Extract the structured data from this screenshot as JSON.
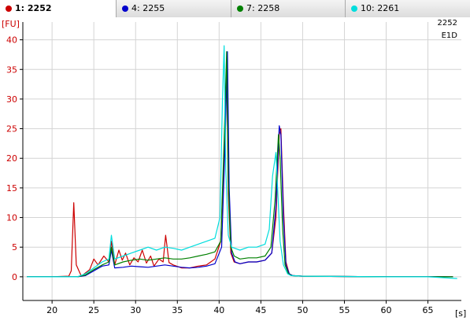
{
  "tabs": [
    {
      "label": "1: 2252",
      "color": "#cc0000",
      "active": true
    },
    {
      "label": "4: 2255",
      "color": "#0000cc",
      "active": false
    },
    {
      "label": "7: 2258",
      "color": "#008000",
      "active": false
    },
    {
      "label": "10: 2261",
      "color": "#00dddd",
      "active": false
    }
  ],
  "sample": {
    "name": "2252",
    "well": "E1D"
  },
  "chart_data": {
    "type": "line",
    "title": "",
    "xlabel": "[s]",
    "ylabel": "[FU]",
    "xlim": [
      16.5,
      69
    ],
    "ylim": [
      -4,
      43
    ],
    "xticks": [
      20,
      25,
      30,
      35,
      40,
      45,
      50,
      55,
      60,
      65
    ],
    "yticks": [
      0,
      5,
      10,
      15,
      20,
      25,
      30,
      35,
      40
    ],
    "grid": true,
    "series": [
      {
        "name": "1: 2252",
        "color": "#cc0000",
        "x": [
          17,
          20,
          22,
          22.3,
          22.6,
          22.9,
          23.5,
          24.5,
          25,
          25.5,
          26.2,
          26.8,
          27.1,
          27.5,
          28,
          28.4,
          28.8,
          29.3,
          29.8,
          30.3,
          30.8,
          31.3,
          31.8,
          32.2,
          32.8,
          33.3,
          33.6,
          34,
          34.5,
          35.5,
          36.5,
          37.5,
          38.5,
          39.5,
          40.2,
          40.6,
          40.9,
          41.1,
          41.4,
          41.8,
          42.5,
          43.5,
          44.5,
          45.5,
          46.3,
          46.8,
          47.2,
          47.4,
          47.7,
          48,
          48.4,
          48.8,
          50,
          55,
          60,
          65,
          68
        ],
        "y": [
          0,
          0,
          0.1,
          1,
          12.5,
          2,
          0.1,
          1.2,
          3,
          2,
          3.5,
          2.5,
          6,
          2,
          4.5,
          2.8,
          4,
          2,
          3.2,
          2.5,
          4.5,
          2.3,
          3.5,
          1.8,
          3,
          2.5,
          7,
          2.4,
          2,
          1.5,
          1.5,
          1.8,
          2,
          3,
          6,
          20,
          36,
          14,
          4,
          2.5,
          2.2,
          2.5,
          2.5,
          2.8,
          4,
          10,
          24,
          25,
          12,
          2.5,
          0.5,
          0.2,
          0.1,
          0.05,
          0,
          0,
          0
        ]
      },
      {
        "name": "4: 2255",
        "color": "#0000cc",
        "x": [
          17,
          22,
          23,
          24,
          25,
          26,
          26.8,
          27.1,
          27.5,
          28.5,
          29.5,
          30.5,
          31.5,
          32.5,
          33.5,
          34.5,
          35.5,
          36.5,
          37.5,
          38.5,
          39.5,
          40.3,
          40.7,
          41,
          41.2,
          41.5,
          41.9,
          42.5,
          43.5,
          44.5,
          45.5,
          46.3,
          46.8,
          47.2,
          47.4,
          47.7,
          48,
          48.4,
          48.8,
          50,
          55,
          60,
          65,
          68
        ],
        "y": [
          0,
          0,
          0,
          0.2,
          1,
          1.8,
          2,
          4.5,
          1.5,
          1.6,
          1.8,
          1.7,
          1.6,
          1.8,
          2,
          1.8,
          1.6,
          1.5,
          1.6,
          1.8,
          2.2,
          5,
          22,
          38,
          15,
          4,
          2.5,
          2.2,
          2.5,
          2.5,
          2.8,
          4,
          12,
          25.5,
          24,
          10,
          2,
          0.5,
          0.2,
          0.1,
          0.05,
          0,
          0,
          0
        ]
      },
      {
        "name": "7: 2258",
        "color": "#008000",
        "x": [
          17,
          22,
          23,
          24,
          25,
          26,
          26.8,
          27.1,
          27.5,
          28.5,
          29.5,
          30.5,
          31.5,
          32.5,
          33.5,
          34.5,
          35.5,
          36.5,
          37.5,
          38.5,
          39.5,
          40.2,
          40.6,
          40.9,
          41.1,
          41.4,
          41.8,
          42.5,
          43.5,
          44.5,
          45.5,
          46.2,
          46.7,
          47.1,
          47.3,
          47.6,
          47.9,
          48.3,
          48.7,
          50,
          55,
          60,
          65,
          68
        ],
        "y": [
          0,
          0,
          0,
          0.3,
          1.2,
          2,
          2.5,
          5,
          2,
          2.5,
          2.8,
          3,
          2.8,
          3,
          3.2,
          3,
          3,
          3.2,
          3.5,
          3.8,
          4.2,
          6,
          23,
          38,
          16,
          5,
          3.5,
          3,
          3.2,
          3.2,
          3.5,
          5,
          13,
          24,
          20,
          8,
          2,
          0.5,
          0.2,
          0.1,
          0.05,
          0,
          0,
          0
        ]
      },
      {
        "name": "10: 2261",
        "color": "#00dddd",
        "x": [
          17,
          22,
          23,
          24,
          25,
          26,
          26.8,
          27.1,
          27.5,
          28.5,
          29.5,
          30.5,
          31.5,
          32.5,
          33.5,
          34.5,
          35.5,
          36.5,
          37.5,
          38.5,
          39.5,
          40.1,
          40.4,
          40.6,
          40.8,
          41.1,
          41.5,
          42.5,
          43.5,
          44.5,
          45.5,
          46,
          46.4,
          46.8,
          47,
          47.3,
          47.7,
          48.2,
          48.6,
          50,
          55,
          60,
          65,
          68.5
        ],
        "y": [
          0,
          0,
          0,
          0.5,
          1.5,
          2.5,
          3,
          7,
          3,
          3.5,
          4,
          4.5,
          5,
          4.5,
          5,
          4.8,
          4.5,
          5,
          5.5,
          6,
          6.5,
          10,
          30,
          39,
          18,
          7,
          5,
          4.5,
          5,
          5,
          5.5,
          8,
          17,
          21,
          15,
          6,
          2,
          0.5,
          0.2,
          0.1,
          0.05,
          0,
          0,
          -0.3
        ]
      }
    ]
  }
}
